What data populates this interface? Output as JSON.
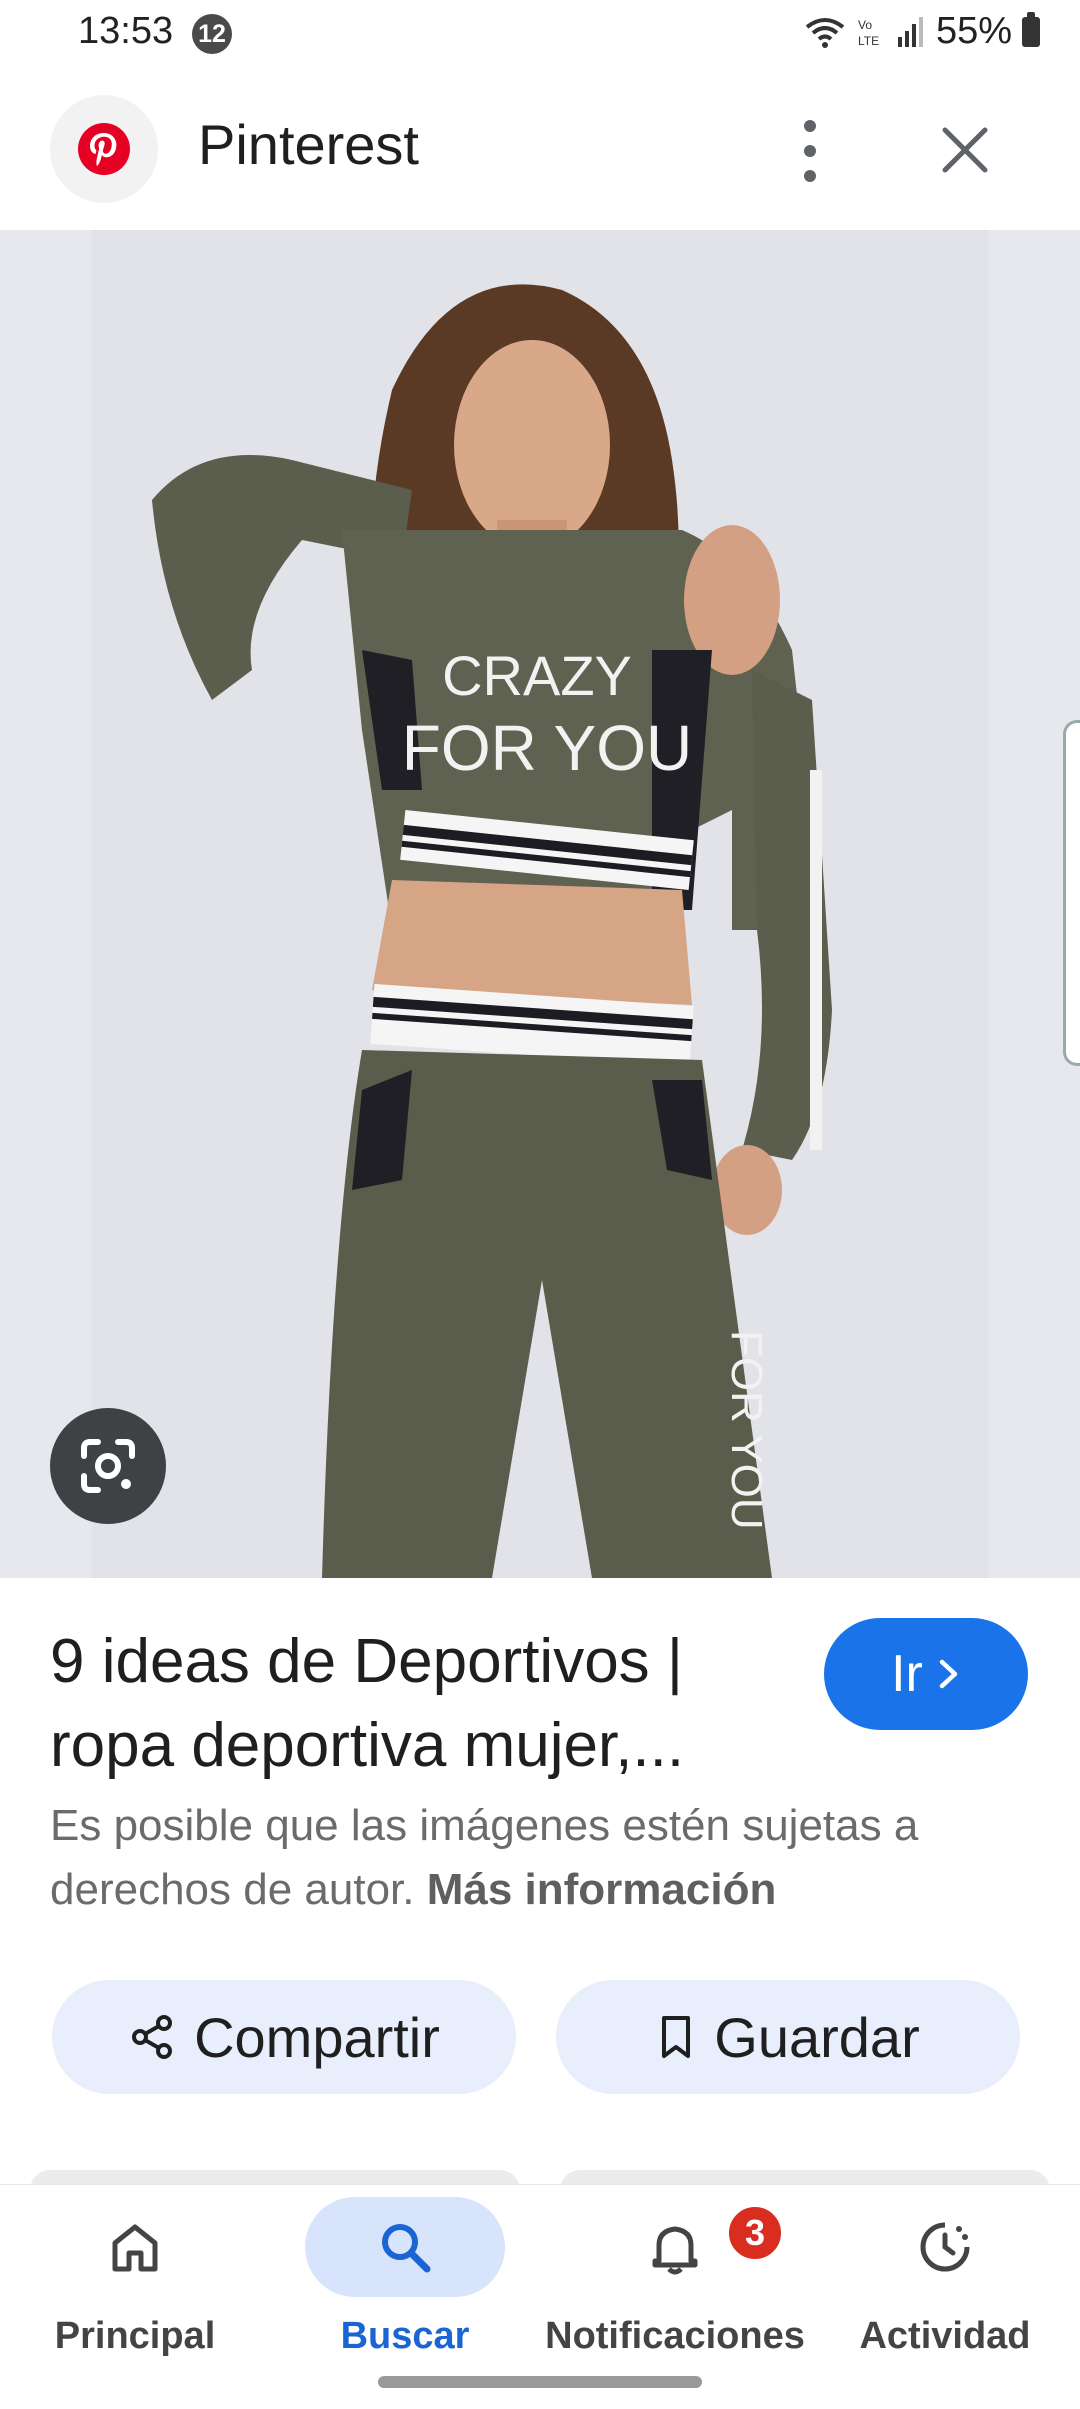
{
  "status_bar": {
    "time": "13:53",
    "notification_count": "12",
    "battery": "55%"
  },
  "header": {
    "title": "Pinterest",
    "brand_color": "#e60023"
  },
  "image": {
    "printed_text_line1": "CRAZY",
    "printed_text_line2": "FOR YOU",
    "side_text": "FOR YOU"
  },
  "result": {
    "title_line1": "9 ideas de Deportivos |",
    "title_line2": "ropa deportiva mujer,...",
    "go_label": "Ir",
    "copyright_text": "Es posible que las imágenes estén sujetas a derechos de autor.",
    "more_info_label": "Más información"
  },
  "actions": {
    "share_label": "Compartir",
    "save_label": "Guardar"
  },
  "bottom_nav": {
    "items": [
      {
        "label": "Principal",
        "icon": "home-icon"
      },
      {
        "label": "Buscar",
        "icon": "search-icon",
        "active": true
      },
      {
        "label": "Notificaciones",
        "icon": "bell-icon",
        "badge": "3"
      },
      {
        "label": "Actividad",
        "icon": "activity-icon"
      }
    ]
  },
  "colors": {
    "accent": "#1a73e8",
    "active_nav": "#1a64d4",
    "badge": "#d92d20"
  }
}
